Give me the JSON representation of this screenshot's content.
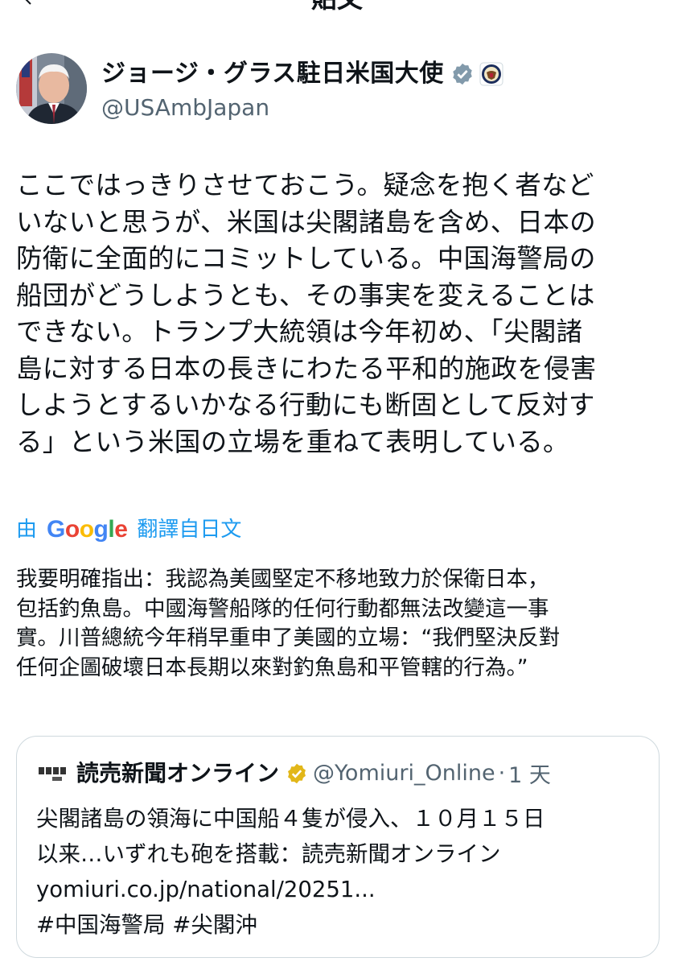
{
  "header": {
    "title": "貼文"
  },
  "author": {
    "name": "ジョージ・グラス駐日米国大使",
    "handle": "@USAmbJapan"
  },
  "tweet": {
    "text": "ここではっきりさせておこう。疑念を抱く者など\nいないと思うが、米国は尖閣諸島を含め、日本の\n防衛に全面的にコミットしている。中国海警局の\n船団がどうしようとも、その事実を変えることは\nできない。トランプ大統領は今年初め、「尖閣諸\n島に対する日本の長きにわたる平和的施政を侵害\nしようとするいかなる行動にも断固として反対す\nる」という米国の立場を重ねて表明している。"
  },
  "translation": {
    "prefix": "由",
    "logo_text": "Google",
    "suffix": "翻譯自日文",
    "text": "我要明確指出：我認為美國堅定不移地致力於保衛日本，\n包括釣魚島。中國海警船隊的任何行動都無法改變這一事\n實。川普總統今年稍早重申了美國的立場：“我們堅決反對\n任何企圖破壞日本長期以來對釣魚島和平管轄的行為。”"
  },
  "quoted": {
    "name": "読売新聞オンライン",
    "handle": "@Yomiuri_Online",
    "separator": "·",
    "time": "1 天",
    "line1": "尖閣諸島の領海に中国船４隻が侵入、１０月１５日",
    "line2": "以来…いずれも砲を搭載：読売新聞オンライン",
    "link": "yomiuri.co.jp/national/20251...",
    "hashtags": [
      "#中国海警局",
      "#尖閣沖"
    ]
  },
  "colors": {
    "link_blue": "#1d9bf0",
    "secondary_text": "#536471",
    "border": "#cfd9de",
    "verified_gray": "#829aab",
    "verified_gold": "#e2b719"
  },
  "icons": [
    "back-arrow-icon",
    "more-icon",
    "verified-badge-icon",
    "state-department-seal-icon",
    "yomiuri-logo-icon"
  ]
}
